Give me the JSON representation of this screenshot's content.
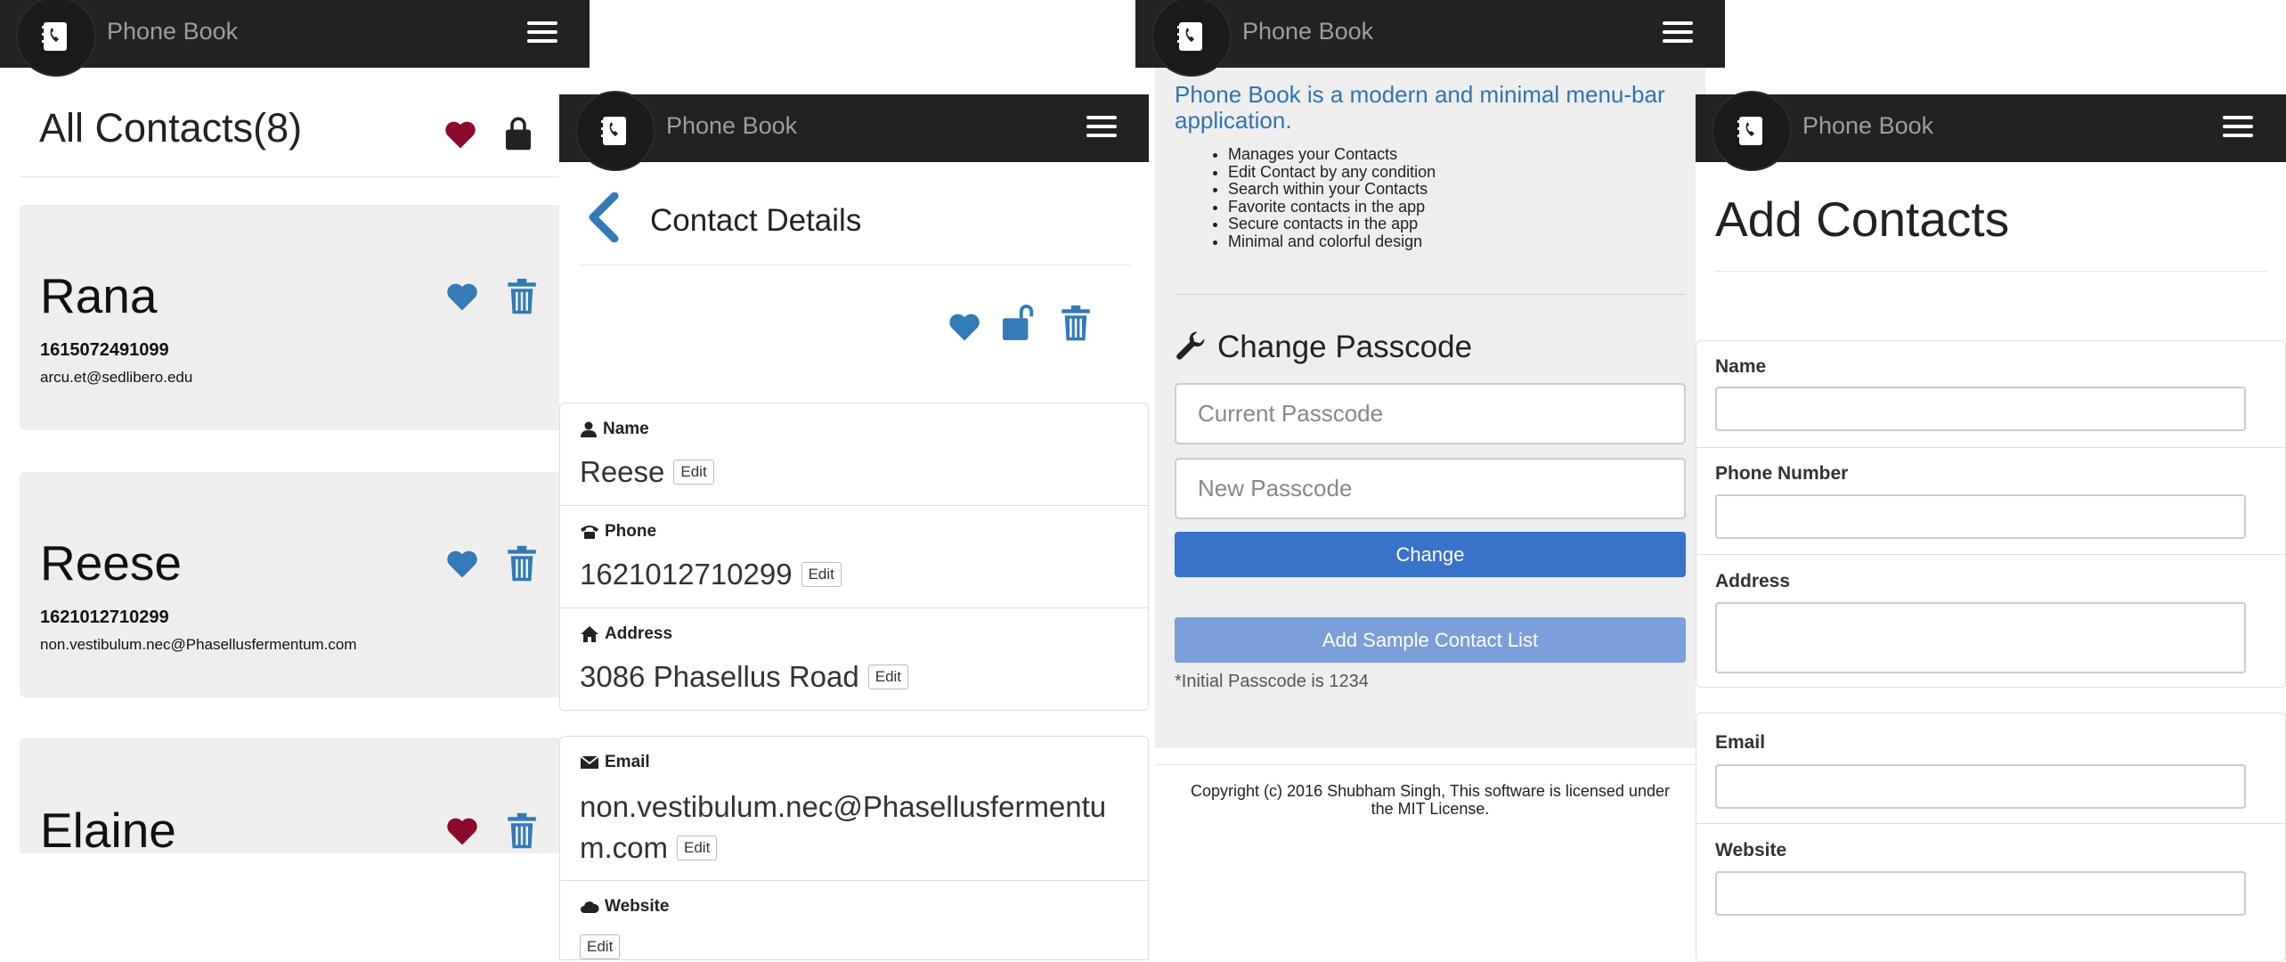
{
  "app": {
    "brand": "Phone Book"
  },
  "colors": {
    "navbar": "#222222",
    "accent": "#337ab7",
    "favorite_red": "#8b0a2e",
    "button_primary": "#3872c9",
    "button_secondary": "#7a9fd9",
    "card_bg": "#eeeeee"
  },
  "screen1": {
    "title": "All Contacts(8)",
    "header_icons": [
      "heart-icon",
      "lock-icon"
    ],
    "contacts": [
      {
        "name": "Rana",
        "phone": "1615072491099",
        "email": "arcu.et@sedlibero.edu",
        "favorite": false
      },
      {
        "name": "Reese",
        "phone": "1621012710299",
        "email": "non.vestibulum.nec@Phasellusfermentum.com",
        "favorite": false
      },
      {
        "name": "Elaine",
        "phone": "",
        "email": "",
        "favorite": true
      }
    ]
  },
  "screen2": {
    "title": "Contact Details",
    "fields": {
      "name_label": "Name",
      "name_value": "Reese",
      "phone_label": "Phone",
      "phone_value": "1621012710299",
      "address_label": "Address",
      "address_value": "3086 Phasellus Road",
      "email_label": "Email",
      "email_value_line1": "non.vestibulum.nec@Phasellusfermentu",
      "email_value_line2": "m.com",
      "website_label": "Website"
    },
    "edit_label": "Edit"
  },
  "screen3": {
    "about_title": "Phone Book is a modern and minimal menu-bar application.",
    "features": [
      "Manages your Contacts",
      "Edit Contact by any condition",
      "Search within your Contacts",
      "Favorite contacts in the app",
      "Secure contacts in the app",
      "Minimal and colorful design"
    ],
    "change_passcode_title": "Change Passcode",
    "current_passcode_placeholder": "Current Passcode",
    "new_passcode_placeholder": "New Passcode",
    "change_button": "Change",
    "sample_button": "Add Sample Contact List",
    "initial_note": "*Initial Passcode is 1234",
    "copyright_line1": "Copyright (c) 2016 Shubham Singh, This software is licensed under",
    "copyright_line2": "the MIT License."
  },
  "screen4": {
    "title": "Add Contacts",
    "name_label": "Name",
    "phone_label": "Phone Number",
    "address_label": "Address",
    "email_label": "Email",
    "website_label": "Website"
  }
}
